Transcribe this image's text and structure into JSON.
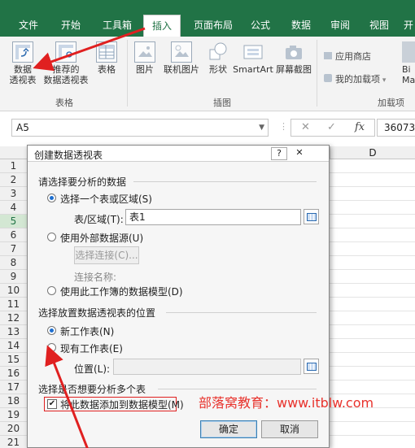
{
  "ribbon": {
    "tabs": [
      "文件",
      "开始",
      "工具箱",
      "插入",
      "页面布局",
      "公式",
      "数据",
      "审阅",
      "视图",
      "开"
    ],
    "active_tab": "插入",
    "buttons": {
      "pivot": [
        "数据",
        "透视表"
      ],
      "recommended_pivot": [
        "推荐的",
        "数据透视表"
      ],
      "table": "表格",
      "picture": "图片",
      "online_picture": "联机图片",
      "shapes": "形状",
      "smartart": "SmartArt",
      "screenshot": "屏幕截图",
      "app_store": "应用商店",
      "my_addins": "我的加载项",
      "bing": [
        "Bi",
        "Ma"
      ]
    },
    "groups": {
      "tables": "表格",
      "illustrations": "插图",
      "addins": "加载项"
    }
  },
  "formula_bar": {
    "name_box": "A5",
    "cancel": "✕",
    "enter": "✓",
    "fx": "fx",
    "content": "36073"
  },
  "grid": {
    "column_d": "D",
    "rows": [
      "1",
      "2",
      "3",
      "4",
      "5",
      "6",
      "7",
      "8",
      "9",
      "10",
      "11",
      "12",
      "13",
      "14",
      "15",
      "16",
      "17",
      "18",
      "19",
      "20",
      "21"
    ],
    "selected_row": "5"
  },
  "dialog": {
    "title": "创建数据透视表",
    "help": "?",
    "close": "✕",
    "section1": "请选择要分析的数据",
    "opt_range": "选择一个表或区域(S)",
    "range_label": "表/区域(T):",
    "range_value": "表1",
    "opt_external": "使用外部数据源(U)",
    "choose_conn": "选择连接(C)...",
    "conn_name": "连接名称:",
    "opt_model": "使用此工作簿的数据模型(D)",
    "section2": "选择放置数据透视表的位置",
    "opt_new": "新工作表(N)",
    "opt_existing": "现有工作表(E)",
    "location_label": "位置(L):",
    "section3": "选择是否想要分析多个表",
    "add_model": "将此数据添加到数据模型(M)",
    "ok": "确定",
    "cancel": "取消"
  },
  "watermark": "部落窝教育：www.itblw.com",
  "colors": {
    "excel_green": "#217346",
    "arrow_red": "#e02020",
    "watermark_red": "#e8322c"
  }
}
